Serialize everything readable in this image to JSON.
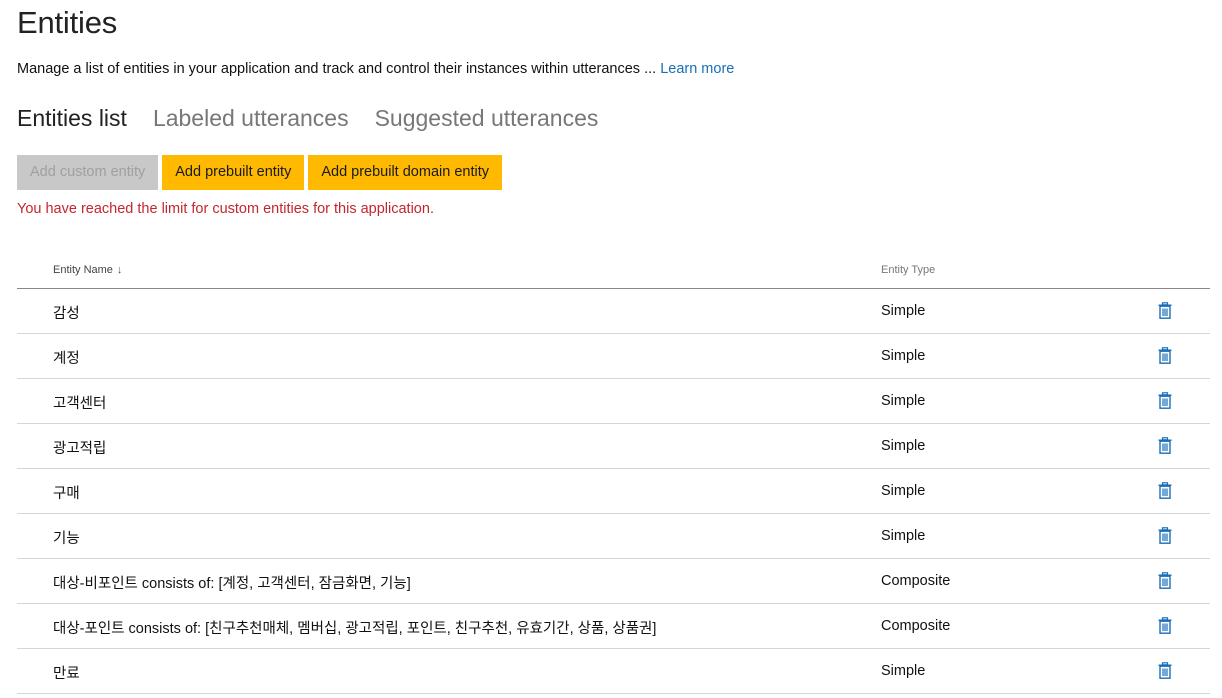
{
  "page": {
    "title": "Entities",
    "description": "Manage a list of entities in your application and track and control their instances within utterances ...",
    "learn_more": "Learn more"
  },
  "tabs": [
    {
      "label": "Entities list",
      "active": true
    },
    {
      "label": "Labeled utterances",
      "active": false
    },
    {
      "label": "Suggested utterances",
      "active": false
    }
  ],
  "toolbar": {
    "add_custom_label": "Add custom entity",
    "add_prebuilt_label": "Add prebuilt entity",
    "add_prebuilt_domain_label": "Add prebuilt domain entity"
  },
  "limit_message": "You have reached the limit for custom entities for this application.",
  "table": {
    "columns": {
      "name": "Entity Name",
      "sort_icon": "arrow-down-icon",
      "type": "Entity Type"
    },
    "rows": [
      {
        "name": "감성",
        "type": "Simple"
      },
      {
        "name": "계정",
        "type": "Simple"
      },
      {
        "name": "고객센터",
        "type": "Simple"
      },
      {
        "name": "광고적립",
        "type": "Simple"
      },
      {
        "name": "구매",
        "type": "Simple"
      },
      {
        "name": "기능",
        "type": "Simple"
      },
      {
        "name": "대상-비포인트 consists of: [계정, 고객센터, 잠금화면, 기능]",
        "type": "Composite"
      },
      {
        "name": "대상-포인트 consists of: [친구추천매체, 멤버십, 광고적립, 포인트, 친구추천, 유효기간, 상품, 상품권]",
        "type": "Composite"
      },
      {
        "name": "만료",
        "type": "Simple"
      }
    ],
    "row_action_icon": "trash-icon"
  },
  "colors": {
    "accent_button": "#ffb900",
    "disabled_button": "#c8c8c8",
    "error_text": "#c4262e",
    "link": "#1a6fb8",
    "trash_icon": "#1a6fb8"
  }
}
